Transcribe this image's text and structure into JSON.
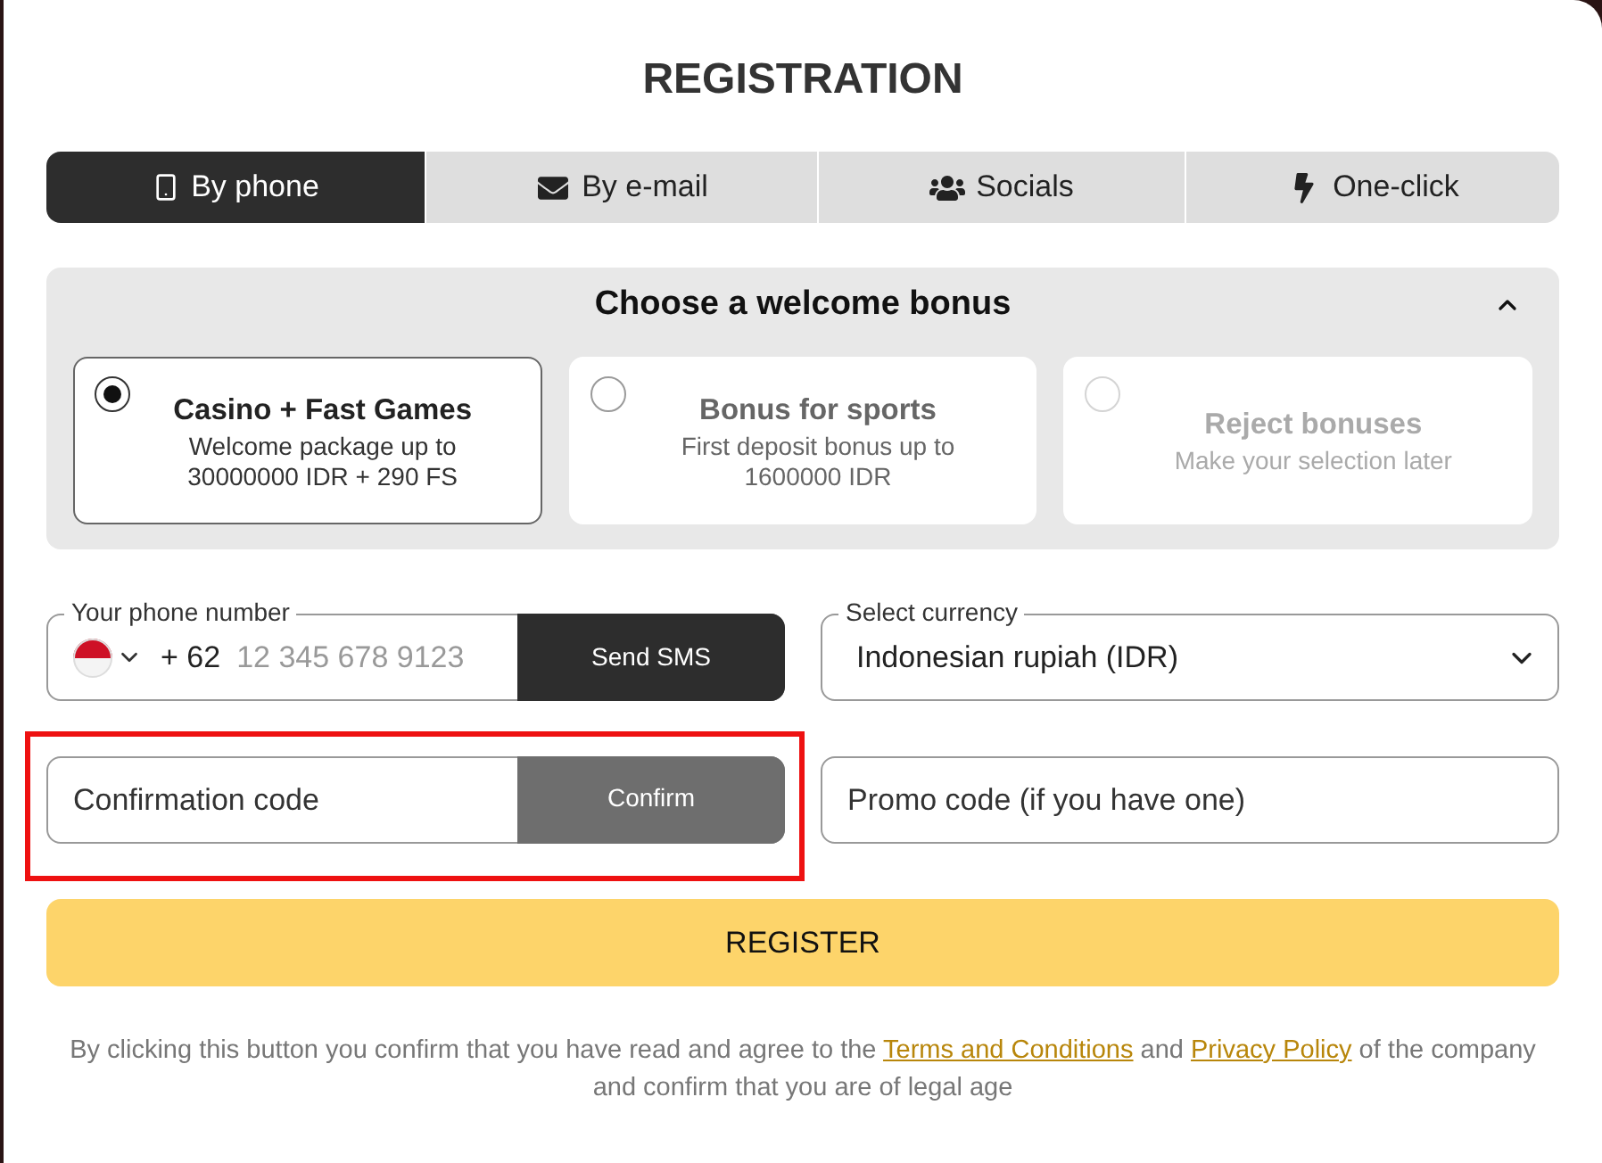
{
  "title": "REGISTRATION",
  "tabs": [
    {
      "label": "By phone",
      "selected": true
    },
    {
      "label": "By e-mail",
      "selected": false
    },
    {
      "label": "Socials",
      "selected": false
    },
    {
      "label": "One-click",
      "selected": false
    }
  ],
  "bonus": {
    "title": "Choose a welcome bonus",
    "expanded": true,
    "options": [
      {
        "title": "Casino + Fast Games",
        "description": "Welcome package up to 30000000 IDR + 290 FS",
        "selected": true,
        "disabled": false
      },
      {
        "title": "Bonus for sports",
        "description": "First deposit bonus up to 1600000 IDR",
        "selected": false,
        "disabled": false
      },
      {
        "title": "Reject bonuses",
        "description": "Make your selection later",
        "selected": false,
        "disabled": true
      }
    ]
  },
  "phone": {
    "label": "Your phone number",
    "country_code": "+ 62",
    "placeholder": "12 345 678 9123",
    "button": "Send SMS"
  },
  "currency": {
    "label": "Select currency",
    "value": "Indonesian rupiah (IDR)"
  },
  "confirmation": {
    "placeholder": "Confirmation code",
    "button": "Confirm",
    "highlighted": true
  },
  "promo": {
    "placeholder": "Promo code (if you have one)"
  },
  "register_button": "REGISTER",
  "terms": [
    {
      "kind": "text",
      "text": "By clicking this button you confirm that you have read and agree to the "
    },
    {
      "kind": "link",
      "text": "Terms and Conditions"
    },
    {
      "kind": "text",
      "text": " and "
    },
    {
      "kind": "link",
      "text": "Privacy Policy"
    },
    {
      "kind": "text",
      "text": " of the company and confirm that you are of legal age"
    }
  ]
}
